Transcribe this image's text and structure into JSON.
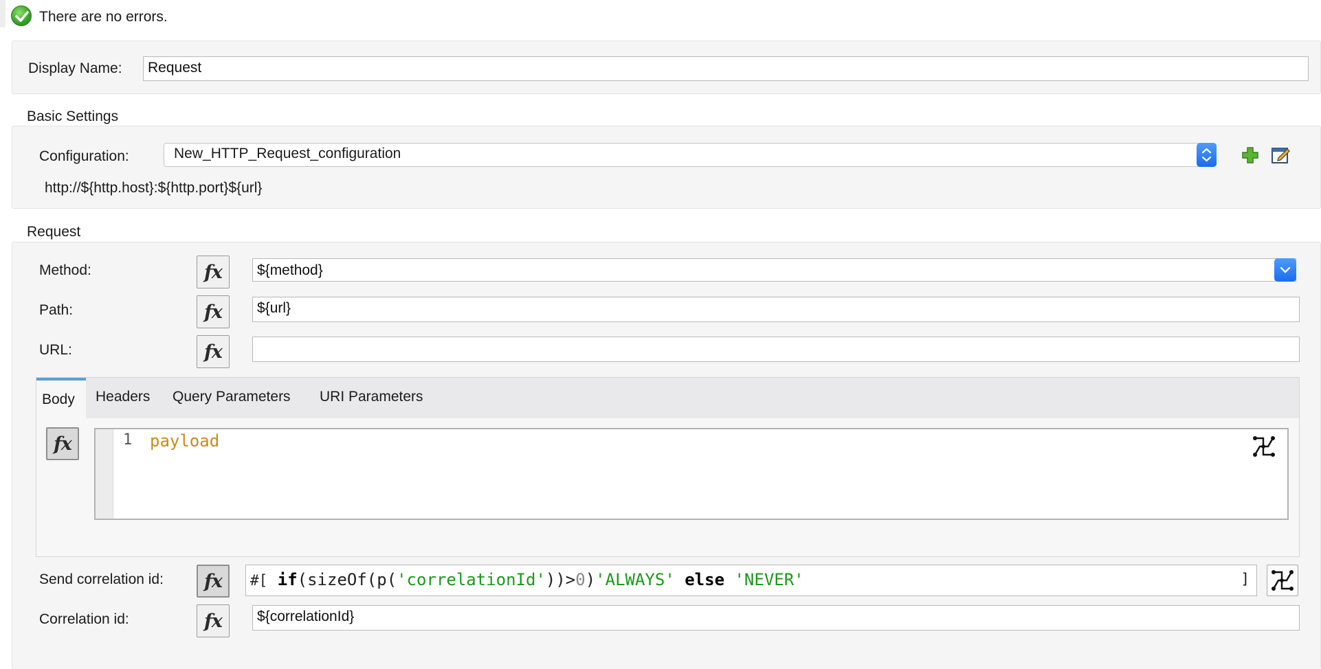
{
  "status": {
    "text": "There are no errors.",
    "icon": "check-circle-icon"
  },
  "display_name": {
    "label": "Display Name:",
    "value": "Request"
  },
  "basic_settings": {
    "title": "Basic Settings",
    "configuration_label": "Configuration:",
    "configuration_value": "New_HTTP_Request_configuration",
    "url_preview": "http://${http.host}:${http.port}${url}",
    "add_icon": "add-icon",
    "edit_icon": "edit-icon"
  },
  "request": {
    "title": "Request",
    "method_label": "Method:",
    "method_value": "${method}",
    "path_label": "Path:",
    "path_value": "${url}",
    "url_label": "URL:",
    "url_value": "",
    "fx_label": "fx",
    "tabs": [
      {
        "label": "Body",
        "active": true
      },
      {
        "label": "Headers",
        "active": false
      },
      {
        "label": "Query Parameters",
        "active": false
      },
      {
        "label": "URI Parameters",
        "active": false
      }
    ],
    "body_editor": {
      "line_number": "1",
      "code": "payload",
      "graph_icon": "dataweave-graph-icon"
    },
    "send_correlation_label": "Send correlation id:",
    "send_correlation_expr": {
      "open": "#[",
      "kw_if": "if",
      "call_open": "(sizeOf(p(",
      "arg": "'correlationId'",
      "call_close": "))>",
      "zero": "0",
      "close_paren": ")",
      "always": "'ALWAYS'",
      "kw_else": "else",
      "never": "'NEVER'",
      "close": "]"
    },
    "correlation_id_label": "Correlation id:",
    "correlation_id_value": "${correlationId}"
  },
  "colors": {
    "accent": "#1a6cf0",
    "keyword": "#000000",
    "string": "#1a9a1a",
    "payload": "#cc8a16",
    "tab_active": "#5aa0d8"
  }
}
